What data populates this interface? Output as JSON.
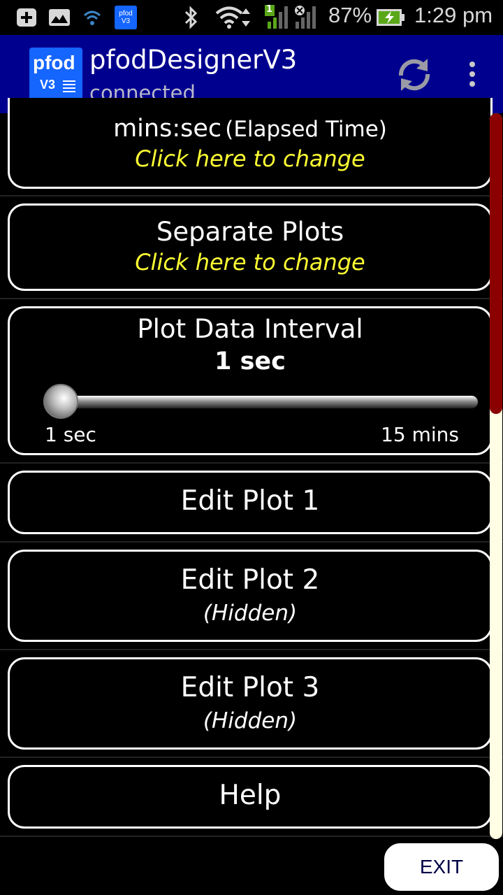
{
  "status_bar": {
    "battery": "87%",
    "time": "1:29 pm",
    "sim_badge": "1",
    "notification_badge_line1": "pfod",
    "notification_badge_line2": "V3"
  },
  "app_bar": {
    "logo_line1": "pfod",
    "logo_line2": "V3",
    "title": "pfodDesignerV3",
    "subtitle": "connected"
  },
  "items": [
    {
      "title": "mins:sec",
      "title_suffix": "(Elapsed Time)",
      "subtitle": "Click here to change"
    },
    {
      "title": "Separate Plots",
      "subtitle": "Click here to change"
    },
    {
      "title": "Plot Data Interval",
      "value": "1 sec",
      "slider_min": "1 sec",
      "slider_max": "15 mins",
      "slider_fraction": 0.0
    },
    {
      "title": "Edit Plot 1"
    },
    {
      "title": "Edit Plot 2",
      "subtitle": "(Hidden)"
    },
    {
      "title": "Edit Plot 3",
      "subtitle": "(Hidden)"
    },
    {
      "title": "Help"
    }
  ],
  "exit_label": "EXIT",
  "colors": {
    "app_bar": "#00008f",
    "accent_yellow": "#ffff33",
    "scroll_thumb": "#8b0000",
    "scroll_track": "#fffde4"
  },
  "icons": [
    "plus-box-icon",
    "image-icon",
    "wifi-small-icon",
    "bluetooth-icon",
    "wifi-icon",
    "signal-icon",
    "battery-charging-icon",
    "refresh-icon",
    "overflow-menu-icon"
  ]
}
